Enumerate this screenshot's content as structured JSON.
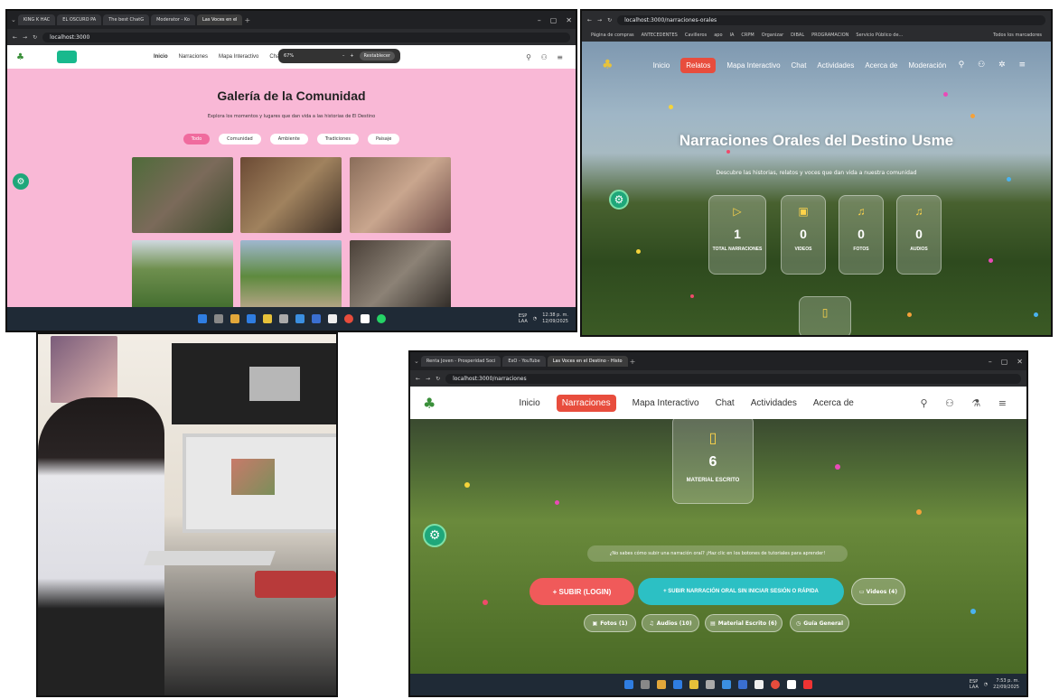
{
  "p1": {
    "tabs": [
      "KING K HAC",
      "EL OSCURO PA",
      "The best ChatG",
      "Moderator - Ko",
      "Las Voces en el"
    ],
    "url": "localhost:3000",
    "zoom": "67%",
    "zoom_reset": "Restablecer",
    "nav": [
      "Inicio",
      "Narraciones",
      "Mapa Interactivo",
      "Chat"
    ],
    "title": "Galería de la Comunidad",
    "subtitle": "Explora los momentos y lugares que dan vida a las historias de El Destino",
    "filters": [
      "Todo",
      "Comunidad",
      "Ambiente",
      "Tradiciones",
      "Paisaje"
    ],
    "tray": {
      "lang": "ESP\nLAA",
      "time": "12:38 p. m.",
      "date": "12/09/2025"
    }
  },
  "p2": {
    "url": "localhost:3000/narraciones-orales",
    "bookmarks": [
      "Página de compras",
      "ANTECEDENTES",
      "Cavilleros",
      "apo",
      "IA",
      "CRPM",
      "Organizar",
      "DIBAL",
      "PROGRAMACION",
      "Servicio Público de...",
      "Todos los marcadores"
    ],
    "nav": [
      "Inicio",
      "Relatos",
      "Mapa Interactivo",
      "Chat",
      "Actividades",
      "Acerca de",
      "Moderación"
    ],
    "title": "Narraciones Orales del Destino Usme",
    "subtitle": "Descubre las historias, relatos y voces que dan vida a nuestra comunidad",
    "stats": [
      {
        "icon": "▷",
        "value": "1",
        "label": "TOTAL NARRACIONES"
      },
      {
        "icon": "▣",
        "value": "0",
        "label": "VIDEOS"
      },
      {
        "icon": "♫",
        "value": "0",
        "label": "FOTOS"
      },
      {
        "icon": "♫",
        "value": "0",
        "label": "AUDIOS"
      }
    ],
    "book_icon": "▯"
  },
  "p4": {
    "tabs": [
      "Renta Joven - Prosperidad Soci",
      "ExO - YouTube",
      "Las Voces en el Destino - Histo"
    ],
    "url": "localhost:3000/narraciones",
    "nav": [
      "Inicio",
      "Narraciones",
      "Mapa Interactivo",
      "Chat",
      "Actividades",
      "Acerca de"
    ],
    "material": {
      "value": "6",
      "label": "MATERIAL ESCRITO"
    },
    "hint": "¿No sabes cómo subir una narración oral? ¡Haz clic en los botones de tutoriales para aprender!",
    "btn_login": "+  SUBIR (LOGIN)",
    "btn_quick": "+  SUBIR NARRACIÓN ORAL SIN INICIAR SESIÓN O RÁPIDA",
    "btn_videos": "▭  Videos (4)",
    "small": [
      "Fotos (1)",
      "Audios (10)",
      "Material Escrito (6)",
      "Guía General"
    ],
    "tray": {
      "lang": "ESP\nLAA",
      "time": "7:53 p. m.",
      "date": "22/09/2025"
    }
  }
}
